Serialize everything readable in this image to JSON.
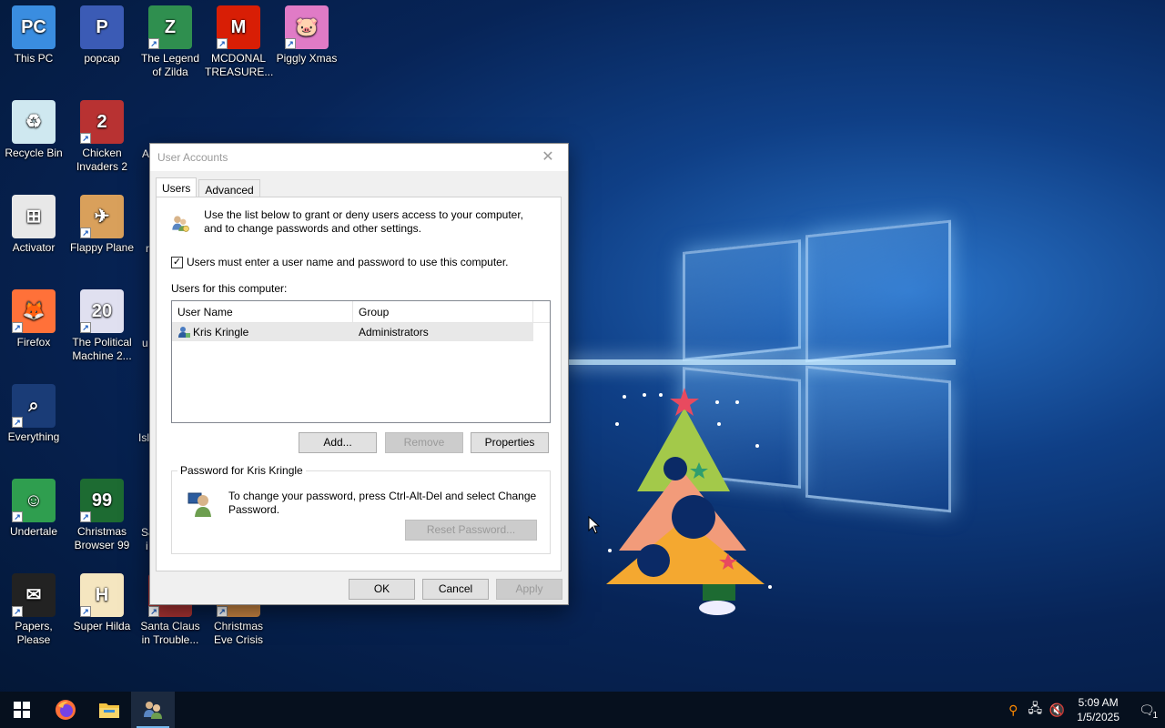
{
  "desktop": {
    "icons": [
      {
        "label": "This PC",
        "name": "this-pc"
      },
      {
        "label": "popcap",
        "name": "popcap"
      },
      {
        "label": "The Legend of Zilda",
        "name": "legend-of-zilda"
      },
      {
        "label": "MCDONAL TREASURE...",
        "name": "mcdonal-treasure"
      },
      {
        "label": "Piggly Xmas",
        "name": "piggly-xmas"
      },
      {
        "label": "Recycle Bin",
        "name": "recycle-bin"
      },
      {
        "label": "Chicken Invaders 2",
        "name": "chicken-invaders-2"
      },
      {
        "label": "Activator",
        "name": "activator"
      },
      {
        "label": "Flappy Plane",
        "name": "flappy-plane"
      },
      {
        "label": "Firefox",
        "name": "firefox"
      },
      {
        "label": "The Political Machine 2...",
        "name": "political-machine"
      },
      {
        "label": "Everything",
        "name": "everything"
      },
      {
        "label": "Undertale",
        "name": "undertale"
      },
      {
        "label": "Christmas Browser 99",
        "name": "christmas-browser-99"
      },
      {
        "label": "Papers, Please",
        "name": "papers-please"
      },
      {
        "label": "Super Hilda",
        "name": "super-hilda"
      },
      {
        "label": "Santa Claus in Trouble...",
        "name": "santa-claus-in-trouble"
      },
      {
        "label": "Christmas Eve Crisis",
        "name": "christmas-eve-crisis"
      }
    ],
    "partial_labels": {
      "a": "A",
      "r": "r",
      "u": "u",
      "isl": "Isl",
      "s": "Sa",
      "i": "i"
    }
  },
  "dialog": {
    "title": "User Accounts",
    "tabs": [
      {
        "label": "Users",
        "active": true
      },
      {
        "label": "Advanced",
        "active": false
      }
    ],
    "intro_text": "Use the list below to grant or deny users access to your computer, and to change passwords and other settings.",
    "require_login_label": "Users must enter a user name and password to use this computer.",
    "require_login_checked": true,
    "users_label": "Users for this computer:",
    "columns": [
      "User Name",
      "Group"
    ],
    "users": [
      {
        "name": "Kris Kringle",
        "group": "Administrators"
      }
    ],
    "buttons": {
      "add": "Add...",
      "remove": "Remove",
      "properties": "Properties",
      "reset_password": "Reset Password...",
      "ok": "OK",
      "cancel": "Cancel",
      "apply": "Apply"
    },
    "password_group_title": "Password for Kris Kringle",
    "password_text": "To change your password, press Ctrl-Alt-Del and select Change Password."
  },
  "taskbar": {
    "time": "5:09 AM",
    "date": "1/5/2025",
    "notification_count": "1"
  },
  "colors": {
    "accent": "#76b9ed",
    "taskbar_bg": "#06101e"
  }
}
